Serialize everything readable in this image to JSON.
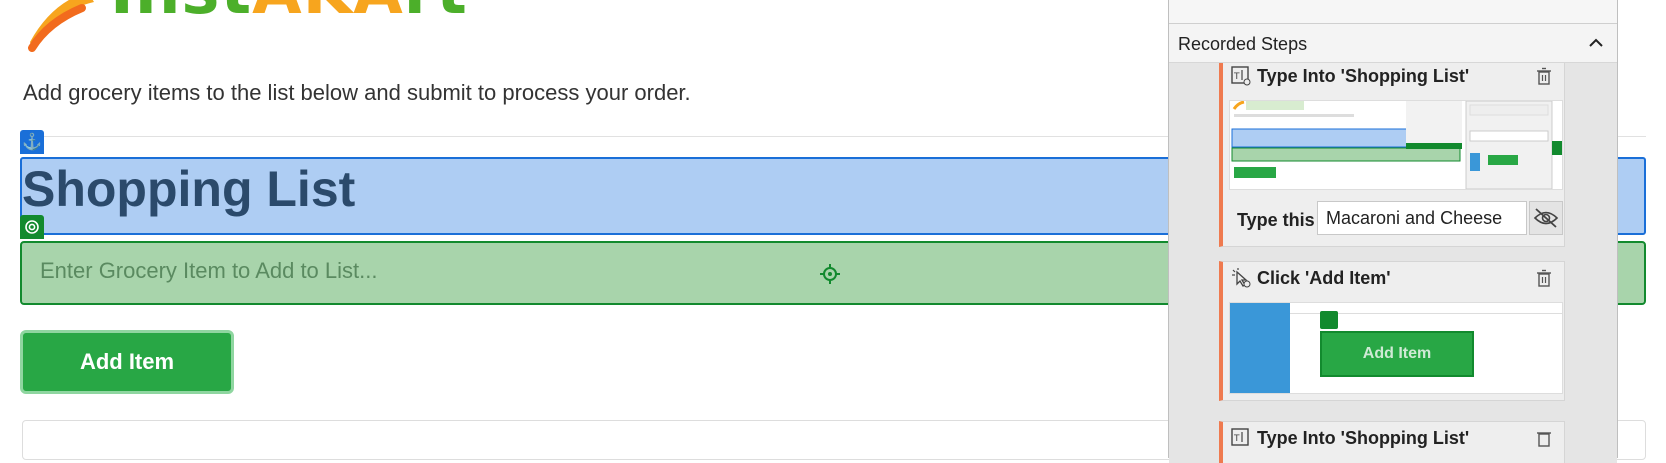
{
  "logo": {
    "brand_green": "Inst",
    "brand_orange": "AKA",
    "brand_green2": "rt"
  },
  "intro_text": "Add grocery items to the list below and submit to process your order.",
  "heading": "Shopping List",
  "input": {
    "placeholder": "Enter Grocery Item to Add to List..."
  },
  "add_button": "Add Item",
  "panel": {
    "section_title": "Recorded Steps",
    "steps": [
      {
        "title": "Type Into 'Shopping List'",
        "type_label": "Type this",
        "type_value": "Macaroni and Cheese"
      },
      {
        "title": "Click 'Add Item'",
        "thumb_button": "Add Item"
      },
      {
        "title": "Type Into 'Shopping List'"
      }
    ]
  },
  "colors": {
    "accent_blue": "#1a6fd8",
    "highlight_green": "#128a2e",
    "button_green": "#28a745",
    "step_accent": "#ef7a4f",
    "logo_green": "#4caf2a",
    "logo_orange": "#f7a51e"
  }
}
